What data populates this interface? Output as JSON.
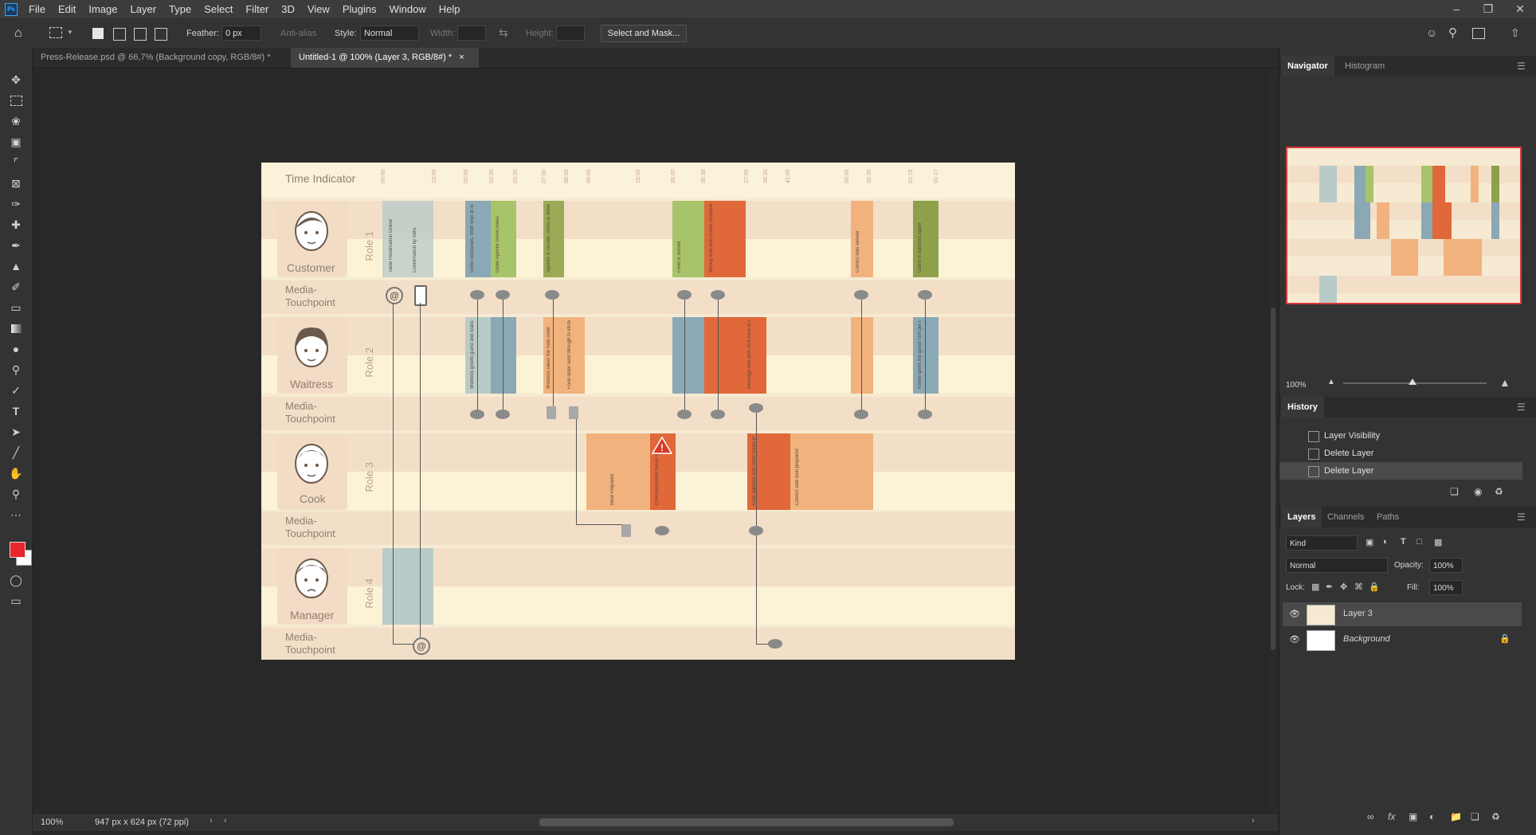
{
  "menu": {
    "app_icon": "Ps",
    "items": [
      "File",
      "Edit",
      "Image",
      "Layer",
      "Type",
      "Select",
      "Filter",
      "3D",
      "View",
      "Plugins",
      "Window",
      "Help"
    ]
  },
  "options_bar": {
    "feather_label": "Feather:",
    "feather_value": "0 px",
    "antialias_label": "Anti-alias",
    "style_label": "Style:",
    "style_value": "Normal",
    "width_label": "Width:",
    "height_label": "Height:",
    "select_mask_label": "Select and Mask..."
  },
  "tabs": [
    {
      "label": "Press-Release.psd @ 66,7% (Background copy, RGB/8#) *",
      "close": "×"
    },
    {
      "label": "Untitled-1 @ 100% (Layer 3, RGB/8#) *",
      "close": "×"
    }
  ],
  "status": {
    "zoom": "100%",
    "doc_info": "947 px x 624 px (72 ppi)"
  },
  "document": {
    "title": "Time Indicator",
    "roles": [
      {
        "name": "Customer",
        "role": "Role 1"
      },
      {
        "name": "Waitress",
        "role": "Role 2"
      },
      {
        "name": "Cook",
        "role": "Role 3"
      },
      {
        "name": "Manager",
        "role": "Role 4"
      }
    ],
    "media_touchpoint": "Media-\nTouchpoint",
    "times": [
      "00:00",
      "15:00",
      "00:00",
      "02:30",
      "03:30",
      "07:00",
      "08:00",
      "09:00",
      "15:00",
      "35:00",
      "35:30",
      "37:00",
      "38:30",
      "41:00",
      "50:00",
      "50:30",
      "01:15",
      "01:17"
    ],
    "blocks": [
      {
        "text": "Table Reservation Online",
        "color": "#b9cbc8"
      },
      {
        "text": "Confirmation by SMS",
        "color": "#b9cbc8"
      },
      {
        "text": "Enter restaurant, short wait at reception",
        "color": "#8aa8b5"
      },
      {
        "text": "Order Aperitiv Given menu",
        "color": "#a8c46a"
      },
      {
        "text": "Aperitiv is served, menu is ordered",
        "color": "#9aaa55"
      },
      {
        "text": "Food is served",
        "color": "#a8c46a"
      },
      {
        "text": "Wrong side dish Guest complains",
        "color": "#e0683a"
      },
      {
        "text": "Correct dish served",
        "color": "#f1b27e"
      },
      {
        "text": "Guest is satisfied again",
        "color": "#8fa04a"
      },
      {
        "text": "Waitress greets guest and leads them to table",
        "color": "#b9cbc8"
      },
      {
        "text": "Waitress takes the food order",
        "color": "#f1b27e"
      },
      {
        "text": "Food order sent through to kitchen",
        "color": "#f1b27e"
      },
      {
        "text": "Message and dish sent back to kitchen",
        "color": "#e0683a"
      },
      {
        "text": "Kelner gives the guest Text per Buchung",
        "color": "#8aa8b5"
      },
      {
        "text": "Meal Prepared",
        "color": "#f1b27e"
      },
      {
        "text": "Communication failure in kitchen",
        "color": "#e0683a"
      },
      {
        "text": "Chef agitated and other meals pushed late in queue to re-do side dish",
        "color": "#e0683a"
      },
      {
        "text": "Correct side dish prepared",
        "color": "#f1b27e"
      }
    ]
  },
  "panels": {
    "navigator_tabs": [
      "Navigator",
      "Histogram"
    ],
    "navigator_zoom": "100%",
    "history_title": "History",
    "history_items": [
      "Layer Visibility",
      "Delete Layer",
      "Delete Layer"
    ],
    "layers_tabs": [
      "Layers",
      "Channels",
      "Paths"
    ],
    "kind_label": "Kind",
    "blend_mode": "Normal",
    "opacity_label": "Opacity:",
    "opacity_value": "100%",
    "lock_label": "Lock:",
    "fill_label": "Fill:",
    "fill_value": "100%",
    "layers": [
      {
        "name": "Layer 3",
        "selected": true
      },
      {
        "name": "Background",
        "selected": false
      }
    ]
  },
  "colors": {
    "foreground": "#e8262b",
    "background": "#ffffff",
    "accent": "#31a8ff"
  }
}
